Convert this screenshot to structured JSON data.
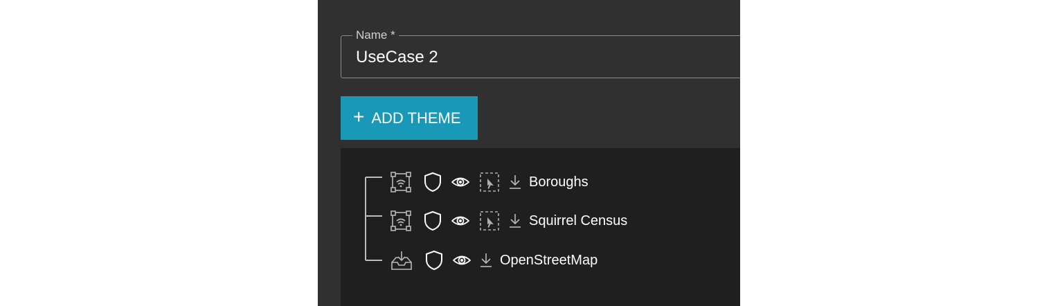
{
  "form": {
    "name_label": "Name *",
    "name_value": "UseCase 2",
    "add_theme_label": "ADD THEME",
    "add_theme_icon": "plus-icon",
    "accent_color": "#1998b8"
  },
  "tree": {
    "items": [
      {
        "label": "Boroughs",
        "type_icon": "wfs-layer-icon",
        "has_select": true
      },
      {
        "label": "Squirrel Census",
        "type_icon": "wfs-layer-icon",
        "has_select": true
      },
      {
        "label": "OpenStreetMap",
        "type_icon": "import-tray-icon",
        "has_select": false
      }
    ],
    "action_icons": [
      "shield-icon",
      "eye-icon",
      "select-region-icon",
      "download-icon"
    ]
  }
}
